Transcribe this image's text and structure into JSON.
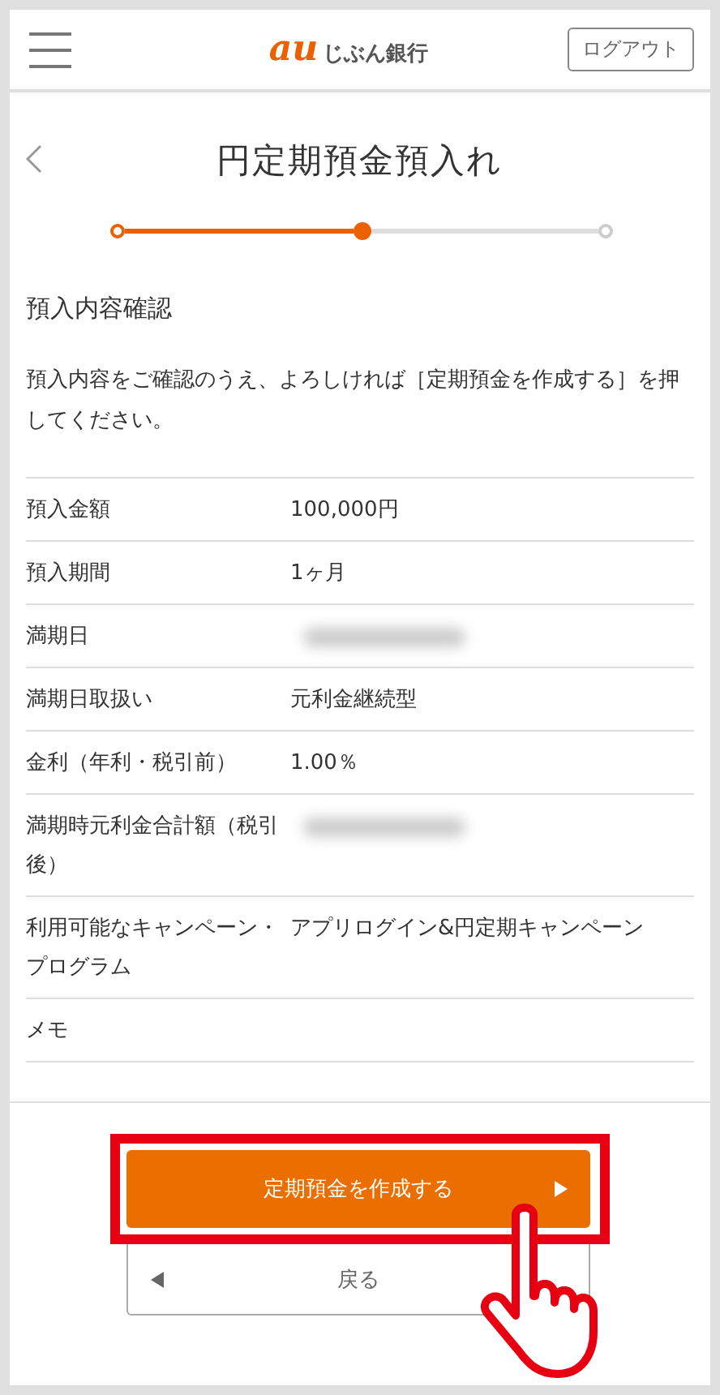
{
  "header": {
    "logo": {
      "mark": "au",
      "text": "じぶん銀行"
    },
    "logout": "ログアウト"
  },
  "title": "円定期預金預入れ",
  "steps": [
    {
      "done": true,
      "current": false
    },
    {
      "done": false,
      "current": true
    },
    {
      "done": false,
      "current": false
    }
  ],
  "section": {
    "heading": "預入内容確認",
    "note": "預入内容をご確認のうえ、よろしければ［定期預金を作成する］を押してください。"
  },
  "rows": [
    {
      "label": "預入金額",
      "value": "100,000円",
      "redacted": false
    },
    {
      "label": "預入期間",
      "value": "1ヶ月",
      "redacted": false
    },
    {
      "label": "満期日",
      "redacted": true
    },
    {
      "label": "満期日取扱い",
      "value": "元利金継続型",
      "redacted": false
    },
    {
      "label": "金利（年利・税引前）",
      "value": "1.00％",
      "redacted": false
    },
    {
      "label": "満期時元利金合計額（税引後）",
      "redacted": true
    },
    {
      "label": "利用可能なキャンペーン・プログラム",
      "value": "アプリログイン&円定期キャンペーン",
      "redacted": false
    },
    {
      "label": "メモ",
      "redacted": false
    }
  ],
  "buttons": {
    "primary": "定期預金を作成する",
    "back": "戻る"
  },
  "highlight": {
    "on": true
  }
}
